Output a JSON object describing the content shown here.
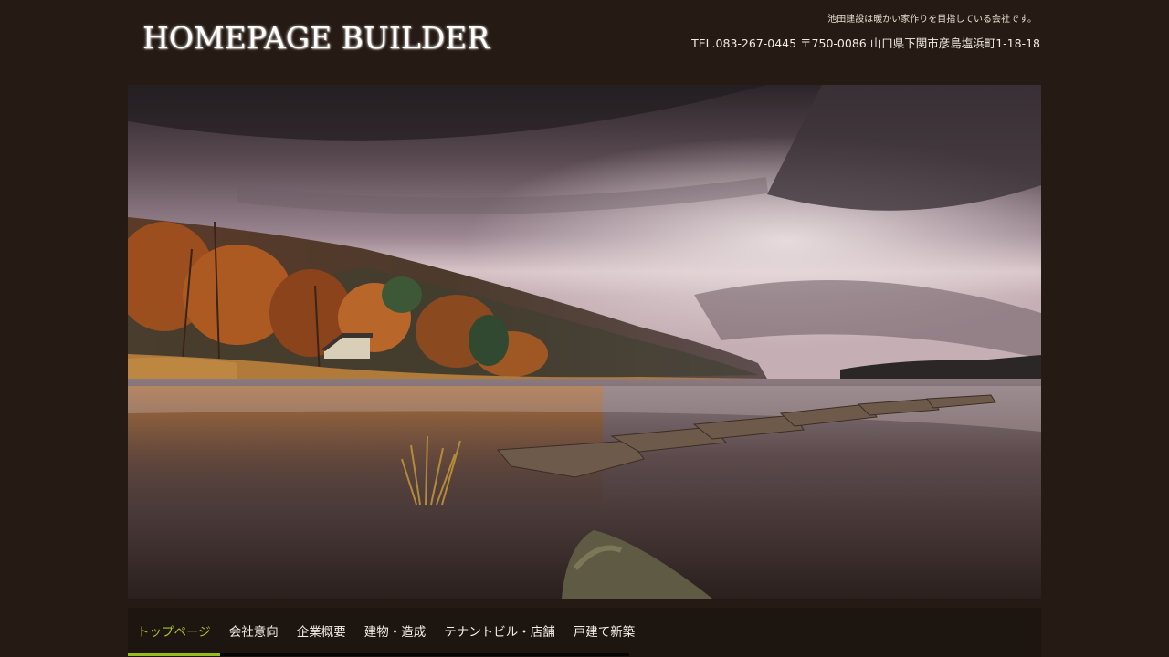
{
  "header": {
    "logo_text": "HOMEPAGE BUILDER",
    "tagline": "池田建設は暖かい家作りを目指している会社です。",
    "contact": "TEL.083-267-0445 〒750-0086 山口県下関市彦島塩浜町1-18-18"
  },
  "hero": {
    "image": "lake-landscape-photo"
  },
  "nav": {
    "items": [
      {
        "label": "トップページ",
        "active": true
      },
      {
        "label": "会社意向",
        "active": false
      },
      {
        "label": "企業概要",
        "active": false
      },
      {
        "label": "建物・造成",
        "active": false
      },
      {
        "label": "テナントビル・店舗",
        "active": false
      },
      {
        "label": "戸建て新築",
        "active": false
      }
    ]
  },
  "colors": {
    "background": "#261b14",
    "nav_background": "#1d1510",
    "accent": "#97bb17"
  }
}
